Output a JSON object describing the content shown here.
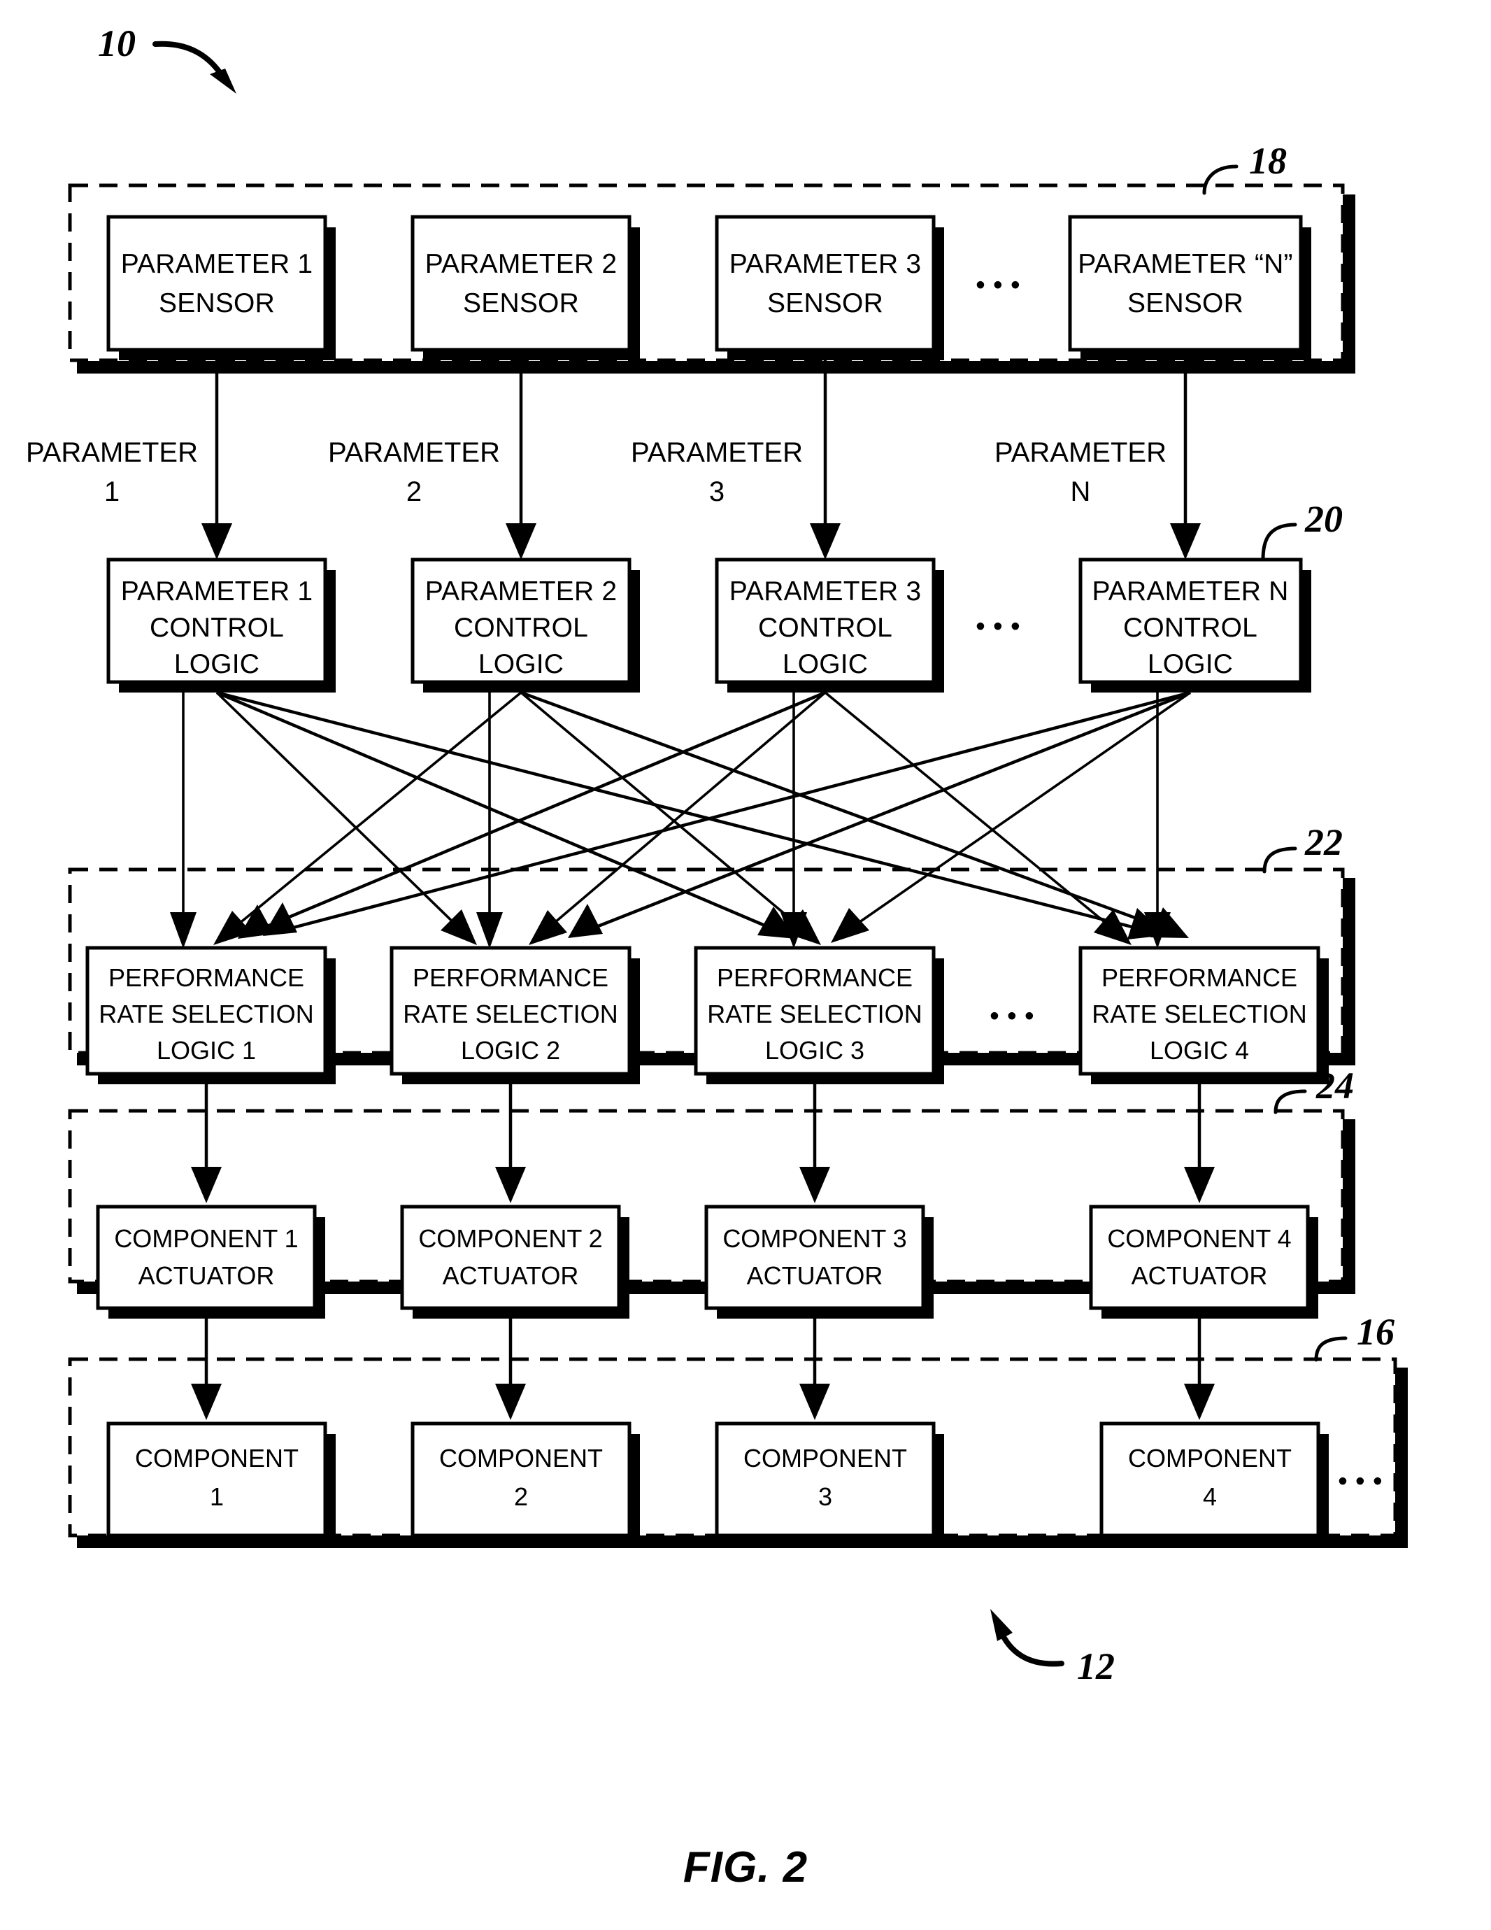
{
  "figure": {
    "caption": "FIG. 2",
    "system_ref": "10",
    "engine_ref": "12"
  },
  "groups": [
    {
      "id": "sensors",
      "ref": "18"
    },
    {
      "id": "actuators",
      "ref": "24"
    },
    {
      "id": "prsl",
      "ref": "22"
    },
    {
      "id": "components",
      "ref": "16"
    }
  ],
  "control_logic_ref": "20",
  "rows": {
    "sensors": {
      "ref": "18",
      "boxes": [
        {
          "line1": "PARAMETER 1",
          "line2": "SENSOR"
        },
        {
          "line1": "PARAMETER 2",
          "line2": "SENSOR"
        },
        {
          "line1": "PARAMETER 3",
          "line2": "SENSOR"
        },
        {
          "line1": "PARAMETER “N”",
          "line2": "SENSOR"
        }
      ],
      "ellipsis": "• • •"
    },
    "parameter_signals": [
      {
        "line1": "PARAMETER",
        "line2": "1"
      },
      {
        "line1": "PARAMETER",
        "line2": "2"
      },
      {
        "line1": "PARAMETER",
        "line2": "3"
      },
      {
        "line1": "PARAMETER",
        "line2": "N"
      }
    ],
    "control_logic": {
      "ref": "20",
      "boxes": [
        {
          "line1": "PARAMETER 1",
          "line2": "CONTROL",
          "line3": "LOGIC"
        },
        {
          "line1": "PARAMETER 2",
          "line2": "CONTROL",
          "line3": "LOGIC"
        },
        {
          "line1": "PARAMETER 3",
          "line2": "CONTROL",
          "line3": "LOGIC"
        },
        {
          "line1": "PARAMETER N",
          "line2": "CONTROL",
          "line3": "LOGIC"
        }
      ],
      "ellipsis": "• • •"
    },
    "performance_rate_selection": {
      "ref": "22",
      "boxes": [
        {
          "line1": "PERFORMANCE",
          "line2": "RATE SELECTION",
          "line3": "LOGIC 1"
        },
        {
          "line1": "PERFORMANCE",
          "line2": "RATE SELECTION",
          "line3": "LOGIC 2"
        },
        {
          "line1": "PERFORMANCE",
          "line2": "RATE SELECTION",
          "line3": "LOGIC 3"
        },
        {
          "line1": "PERFORMANCE",
          "line2": "RATE SELECTION",
          "line3": "LOGIC 4"
        }
      ],
      "ellipsis": "• • •"
    },
    "component_actuators": {
      "ref": "24",
      "boxes": [
        {
          "line1": "COMPONENT 1",
          "line2": "ACTUATOR"
        },
        {
          "line1": "COMPONENT 2",
          "line2": "ACTUATOR"
        },
        {
          "line1": "COMPONENT 3",
          "line2": "ACTUATOR"
        },
        {
          "line1": "COMPONENT 4",
          "line2": "ACTUATOR"
        }
      ]
    },
    "components": {
      "ref": "16",
      "boxes": [
        {
          "line1": "COMPONENT",
          "line2": "1"
        },
        {
          "line1": "COMPONENT",
          "line2": "2"
        },
        {
          "line1": "COMPONENT",
          "line2": "3"
        },
        {
          "line1": "COMPONENT",
          "line2": "4"
        }
      ],
      "ellipsis": "• • •"
    }
  },
  "colors": {
    "ink": "#000000",
    "paper": "#ffffff"
  }
}
